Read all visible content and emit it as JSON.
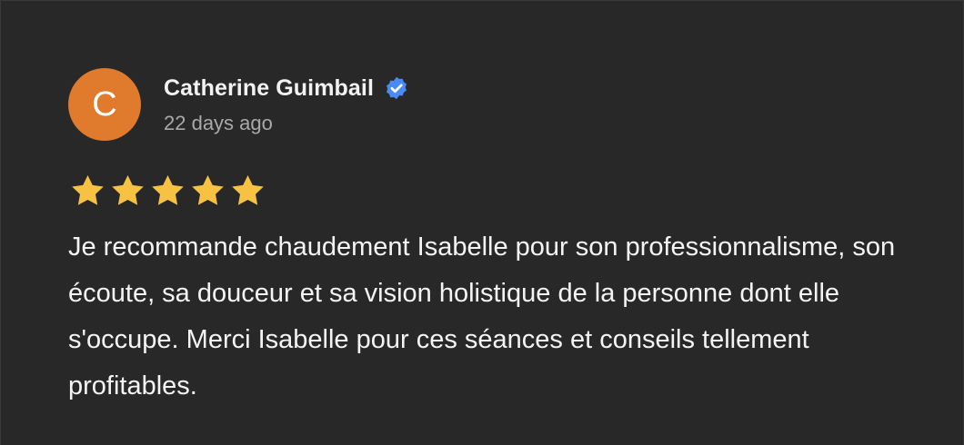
{
  "review": {
    "avatar_initial": "C",
    "avatar_color": "#e07a2c",
    "author_name": "Catherine Guimbail",
    "verified_icon": "verified-badge-icon",
    "verified_color": "#4a8af4",
    "time_ago": "22 days ago",
    "rating": 5,
    "rating_max": 5,
    "star_color": "#f7c143",
    "text": "Je recommande chaudement Isabelle pour son professionnalisme, son écoute, sa douceur et sa vision holistique de la personne dont elle s'occupe. Merci Isabelle pour ces séances et conseils tellement profitables."
  }
}
